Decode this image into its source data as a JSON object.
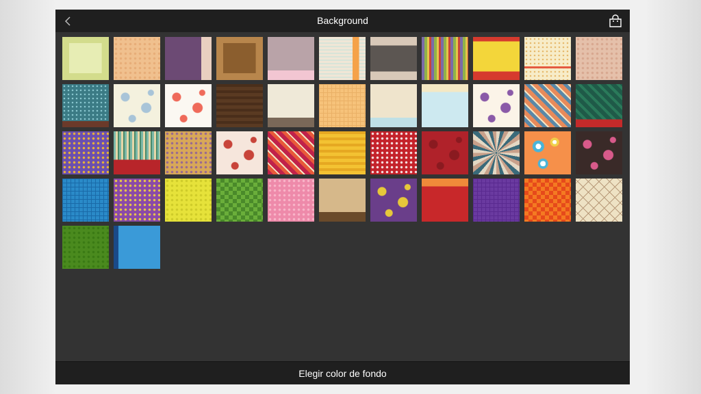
{
  "header": {
    "title": "Background",
    "back_icon": "chevron-left-icon",
    "store_icon": "shopping-bag-icon"
  },
  "footer": {
    "label": "Elegir color de fondo"
  },
  "colors": {
    "frame_bg": "#333333",
    "bar_bg": "#1f1f1f",
    "text": "#ffffff"
  },
  "backgrounds": [
    {
      "name": "pale-green-frame",
      "base": "#e7edb4",
      "accent": "#d3dc8c",
      "pattern": "frame"
    },
    {
      "name": "peach-dots",
      "base": "#f0c08e",
      "accent": "#e7ad78",
      "pattern": "dots"
    },
    {
      "name": "purple-dots-beige-stripe",
      "base": "#6c4a74",
      "accent": "#e9cfc0",
      "pattern": "side-stripe"
    },
    {
      "name": "brown-floral-frame",
      "base": "#8b5e2e",
      "accent": "#b8864c",
      "pattern": "frame"
    },
    {
      "name": "mauve-lace-pink-band",
      "base": "#b9a3a8",
      "accent": "#f2c6d2",
      "pattern": "bottom-band"
    },
    {
      "name": "cream-stripes-orange",
      "base": "#f0e6d6",
      "accent": "#f5a24a",
      "pattern": "vstripes-right"
    },
    {
      "name": "gray-band-lace",
      "base": "#d8c8b8",
      "accent": "#5c5652",
      "pattern": "mid-band"
    },
    {
      "name": "multicolor-stripes",
      "base": "#7b6ba8",
      "accent": "#8fb24a",
      "pattern": "vstripes"
    },
    {
      "name": "yellow-red-bands",
      "base": "#f3d63a",
      "accent": "#d63a2e",
      "pattern": "top-bottom-band"
    },
    {
      "name": "cream-polka-red-line",
      "base": "#f7ecc8",
      "accent": "#e45a40",
      "pattern": "dots-line"
    },
    {
      "name": "peach-stitch",
      "base": "#e5c0aa",
      "accent": "#d8a890",
      "pattern": "dots"
    },
    {
      "name": "teal-dots-brown-band",
      "base": "#3b7b85",
      "accent": "#6b3a2a",
      "pattern": "dots-band"
    },
    {
      "name": "cream-blue-floral",
      "base": "#f4f1de",
      "accent": "#a8c4d8",
      "pattern": "blobs"
    },
    {
      "name": "white-retro-flowers",
      "base": "#fbf8f2",
      "accent": "#ef6a5a",
      "pattern": "blobs"
    },
    {
      "name": "dark-brown-wood",
      "base": "#5a3a22",
      "accent": "#4a2e1a",
      "pattern": "hstripes"
    },
    {
      "name": "cream-brown-band",
      "base": "#efe9d8",
      "accent": "#7a6858",
      "pattern": "bottom-band"
    },
    {
      "name": "peach-grid",
      "base": "#f6c27a",
      "accent": "#eab066",
      "pattern": "grid"
    },
    {
      "name": "cream-stripe-blue-band",
      "base": "#efe4cc",
      "accent": "#bfe0e6",
      "pattern": "bottom-band"
    },
    {
      "name": "blue-cream-bands",
      "base": "#cde9f0",
      "accent": "#f4e8c4",
      "pattern": "top-band"
    },
    {
      "name": "confetti-stars",
      "base": "#fbf4e8",
      "accent": "#8a5aa8",
      "pattern": "blobs"
    },
    {
      "name": "diagonal-multicolor",
      "base": "#e88a5a",
      "accent": "#5a88a8",
      "pattern": "diag"
    },
    {
      "name": "green-stripes-red-band",
      "base": "#1f5a48",
      "accent": "#c42a2a",
      "pattern": "diag-band"
    },
    {
      "name": "purple-circles",
      "base": "#6a4fb0",
      "accent": "#e6b03a",
      "pattern": "dots"
    },
    {
      "name": "striped-red-band",
      "base": "#7ab8a8",
      "accent": "#b8252a",
      "pattern": "vstripes-band"
    },
    {
      "name": "tan-lace",
      "base": "#d8a858",
      "accent": "#9a6a90",
      "pattern": "dots"
    },
    {
      "name": "cream-red-birds",
      "base": "#f6e6dc",
      "accent": "#c8443a",
      "pattern": "blobs"
    },
    {
      "name": "red-diagonals",
      "base": "#c0224a",
      "accent": "#e85a3a",
      "pattern": "diag"
    },
    {
      "name": "yellow-zigzag",
      "base": "#f3c232",
      "accent": "#e6a822",
      "pattern": "hstripes"
    },
    {
      "name": "red-medallions",
      "base": "#c4222a",
      "accent": "#f4dede",
      "pattern": "dots"
    },
    {
      "name": "red-floral-damask",
      "base": "#b0222a",
      "accent": "#8a1a20",
      "pattern": "blobs"
    },
    {
      "name": "sunburst",
      "base": "#e4d8c4",
      "accent": "#3a6a7a",
      "pattern": "burst"
    },
    {
      "name": "orange-retro-circles",
      "base": "#f6904a",
      "accent": "#4ab4d8",
      "pattern": "circles"
    },
    {
      "name": "dark-pink-flowers",
      "base": "#3a2a28",
      "accent": "#d85a8a",
      "pattern": "blobs"
    },
    {
      "name": "blue-tile",
      "base": "#2a8ac8",
      "accent": "#1a6aa8",
      "pattern": "grid"
    },
    {
      "name": "purple-diamonds",
      "base": "#8a4aa8",
      "accent": "#e6c44a",
      "pattern": "dots"
    },
    {
      "name": "yellow-dots",
      "base": "#e6e23a",
      "accent": "#cfcc2a",
      "pattern": "dots"
    },
    {
      "name": "green-harlequin",
      "base": "#6aae3a",
      "accent": "#4a8a2a",
      "pattern": "harlequin"
    },
    {
      "name": "pink-flowers",
      "base": "#ee8aaa",
      "accent": "#f8b4c8",
      "pattern": "dots"
    },
    {
      "name": "tan-paisley",
      "base": "#d6b88a",
      "accent": "#6a4a2a",
      "pattern": "bottom-band"
    },
    {
      "name": "purple-yellow-flowers",
      "base": "#6a3e8a",
      "accent": "#e6c83a",
      "pattern": "blobs"
    },
    {
      "name": "red-stripe-top",
      "base": "#c8282a",
      "accent": "#f08a3a",
      "pattern": "top-band"
    },
    {
      "name": "purple-solid",
      "base": "#6a3aa0",
      "accent": "#5a2a90",
      "pattern": "grid"
    },
    {
      "name": "orange-harlequin",
      "base": "#f47a22",
      "accent": "#e64a1a",
      "pattern": "harlequin"
    },
    {
      "name": "cream-diamond-lattice",
      "base": "#eee2c4",
      "accent": "#b89a7a",
      "pattern": "lattice"
    },
    {
      "name": "green-dots",
      "base": "#4a8a1e",
      "accent": "#3a7a14",
      "pattern": "dots"
    },
    {
      "name": "blue-dots-stripe",
      "base": "#3a9ad8",
      "accent": "#1a4a88",
      "pattern": "side-stripe-left"
    }
  ]
}
